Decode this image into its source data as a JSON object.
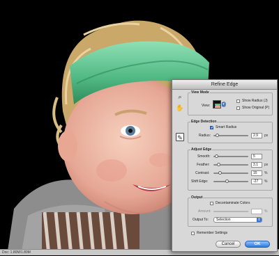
{
  "dialog": {
    "title": "Refine Edge",
    "view_mode": {
      "title": "View Mode",
      "view_label": "View:",
      "show_radius": "Show Radius (J)",
      "show_original": "Show Original (P)"
    },
    "edge_detection": {
      "title": "Edge Detection",
      "smart_radius": "Smart Radius",
      "smart_radius_checked": true,
      "radius_label": "Radius:",
      "radius_value": "2.9",
      "radius_unit": "px"
    },
    "adjust_edge": {
      "title": "Adjust Edge",
      "rows": [
        {
          "label": "Smooth:",
          "value": "5",
          "unit": ""
        },
        {
          "label": "Feather:",
          "value": "3.1",
          "unit": "px"
        },
        {
          "label": "Contrast:",
          "value": "15",
          "unit": "%"
        },
        {
          "label": "Shift Edge:",
          "value": "-27",
          "unit": "%"
        }
      ]
    },
    "output": {
      "title": "Output",
      "decontaminate": "Decontaminate Colors",
      "amount_label": "Amount:",
      "amount_unit": "%",
      "output_to_label": "Output To:",
      "output_to_value": "Selection"
    },
    "remember": "Remember Settings",
    "cancel": "Cancel",
    "ok": "OK"
  },
  "statusbar": {
    "text": "Doc: 1.80M/1.80M"
  },
  "colors": {
    "accent": "#3b75d6",
    "dialog_bg": "#d8d8d8",
    "headband": "#5fc08c"
  }
}
